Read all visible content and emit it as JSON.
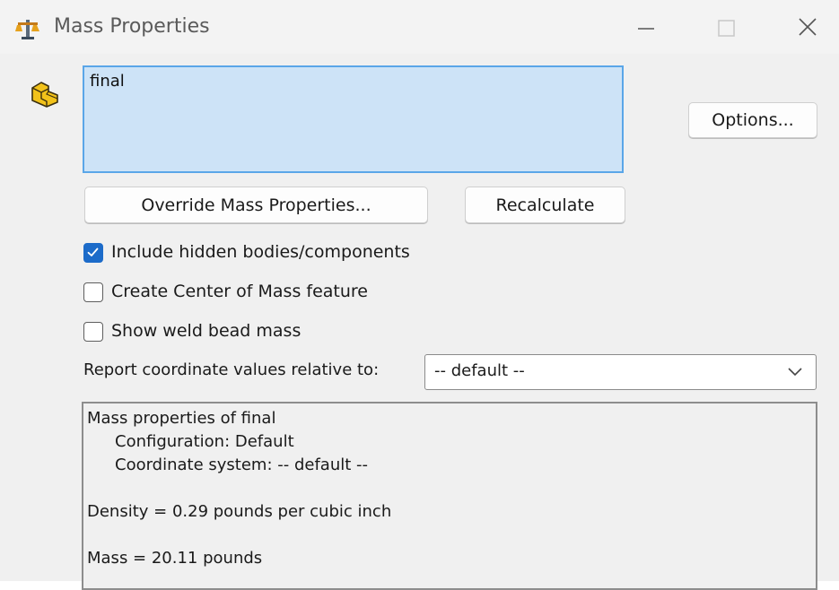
{
  "window": {
    "title": "Mass Properties"
  },
  "selection": {
    "items": [
      "final"
    ]
  },
  "buttons": {
    "options": "Options...",
    "override": "Override Mass Properties...",
    "recalculate": "Recalculate"
  },
  "checkboxes": [
    {
      "label": "Include hidden bodies/components",
      "checked": true
    },
    {
      "label": "Create Center of Mass feature",
      "checked": false
    },
    {
      "label": "Show weld bead mass",
      "checked": false
    }
  ],
  "report": {
    "label": "Report coordinate values relative to:",
    "selected": "-- default --"
  },
  "results": {
    "lines": [
      "Mass properties of final",
      "Configuration: Default",
      "Coordinate system: -- default --",
      "Density = 0.29 pounds per cubic inch",
      "Mass = 20.11 pounds"
    ]
  },
  "icons": {
    "app": "balance-scale-icon",
    "part": "part-block-icon",
    "dropdown": "chevron-down-icon",
    "check": "checkmark-icon"
  },
  "colors": {
    "accent": "#1c6bc9",
    "selection_bg": "#cde3f7",
    "selection_border": "#5aa6e8"
  }
}
